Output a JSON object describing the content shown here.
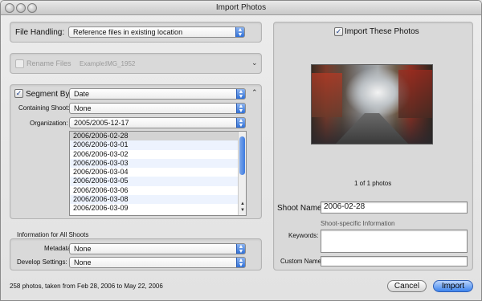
{
  "window": {
    "title": "Import Photos"
  },
  "file_handling": {
    "label": "File Handling:",
    "value": "Reference files in existing location"
  },
  "rename": {
    "label": "Rename Files",
    "example_label": "Example:",
    "example_value": "IMG_1952",
    "checked": false
  },
  "segment": {
    "label": "Segment By:",
    "checked": true,
    "value": "Date",
    "containing_shoot_label": "Containing Shoot:",
    "containing_shoot_value": "None",
    "organization_label": "Organization:",
    "organization_value": "2005/2005-12-17",
    "shoots": [
      "2006/2006-02-28",
      "2006/2006-03-01",
      "2006/2006-03-02",
      "2006/2006-03-03",
      "2006/2006-03-04",
      "2006/2006-03-05",
      "2006/2006-03-06",
      "2006/2006-03-08",
      "2006/2006-03-09"
    ]
  },
  "all_shoots": {
    "heading": "Information for All Shoots",
    "metadata_label": "Metadata:",
    "metadata_value": "None",
    "develop_label": "Develop Settings:",
    "develop_value": "None"
  },
  "status": "258 photos, taken from Feb 28, 2006 to May 22, 2006",
  "right": {
    "import_label": "Import These Photos",
    "import_checked": true,
    "photo_count": "1 of 1 photos",
    "shoot_name_label": "Shoot Name:",
    "shoot_name_value": "2006-02-28",
    "shoot_specific_heading": "Shoot-specific Information",
    "keywords_label": "Keywords:",
    "keywords_value": "",
    "custom_name_label": "Custom Name:",
    "custom_name_value": ""
  },
  "buttons": {
    "cancel": "Cancel",
    "import": "Import"
  },
  "colors": {
    "accent": "#3d84ee",
    "selected_row": "#d3d3d3",
    "alt_row": "#edf3fe"
  }
}
